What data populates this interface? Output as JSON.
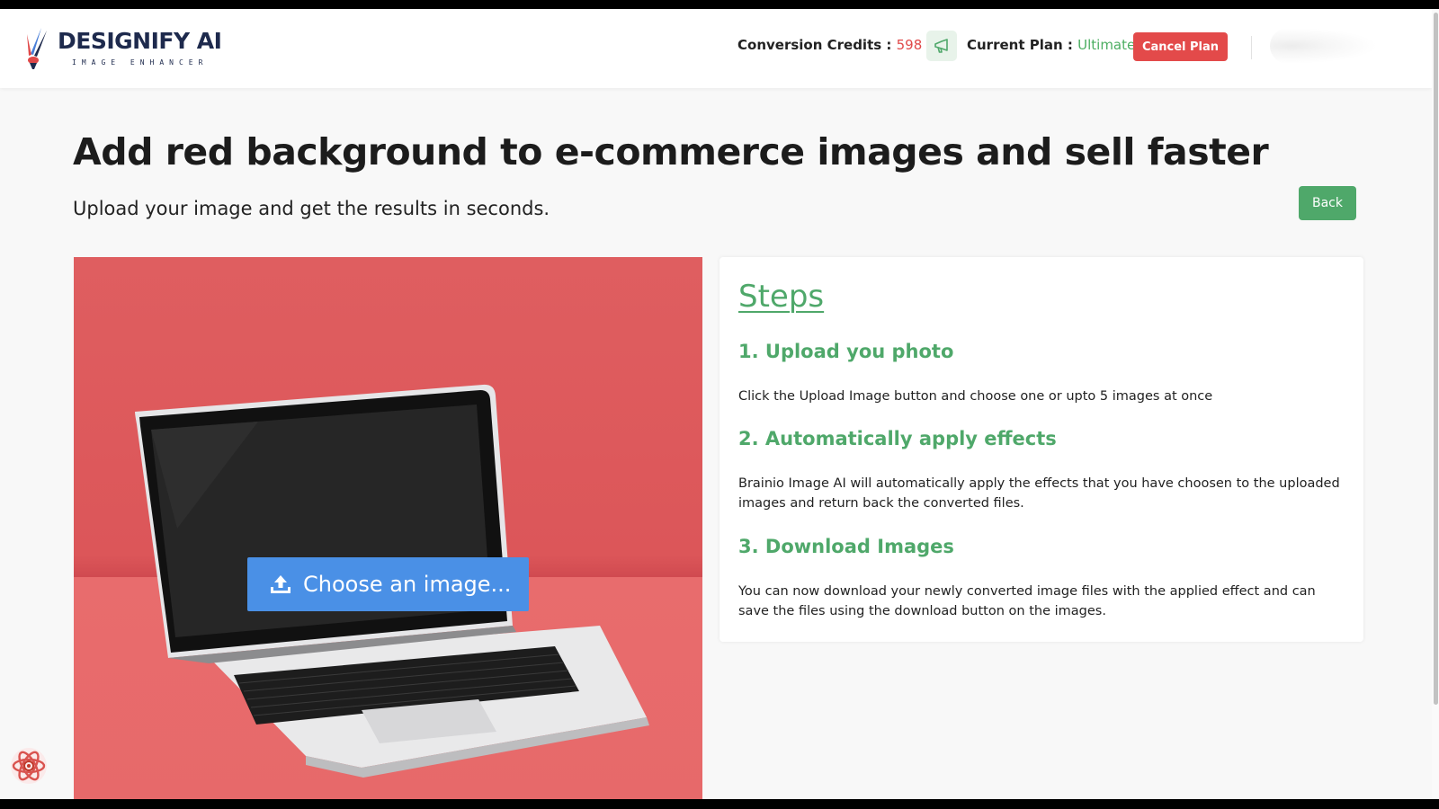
{
  "header": {
    "logo": {
      "title": "DESIGNIFY AI",
      "subtitle": "IMAGE ENHANCER"
    },
    "credits": {
      "label": "Conversion Credits :",
      "value": "598"
    },
    "plan": {
      "icon": "megaphone-icon",
      "label": "Current Plan :",
      "value": "Ultimate"
    },
    "cancel_label": "Cancel Plan"
  },
  "main": {
    "title": "Add red background to e-commerce images and sell faster",
    "subtitle": "Upload your image and get the results in seconds.",
    "back_label": "Back",
    "upload": {
      "label": "Choose an image...",
      "icon": "upload-icon"
    }
  },
  "steps": {
    "title": "Steps",
    "items": [
      {
        "heading": "1. Upload you photo",
        "text": "Click the Upload Image button and choose one or upto 5 images at once"
      },
      {
        "heading": "2. Automatically apply effects",
        "text": "Brainio Image AI will automatically apply the effects that you have choosen to the uploaded images and return back the converted files."
      },
      {
        "heading": "3. Download Images",
        "text": "You can now download your newly converted image files with the applied effect and can save the files using the download button on the images."
      }
    ]
  },
  "colors": {
    "accent_green": "#4fa86a",
    "danger_red": "#e34a4a",
    "upload_blue": "#4a90e6",
    "canvas_red": "#dc5659",
    "brand_navy": "#1e2a4d"
  }
}
